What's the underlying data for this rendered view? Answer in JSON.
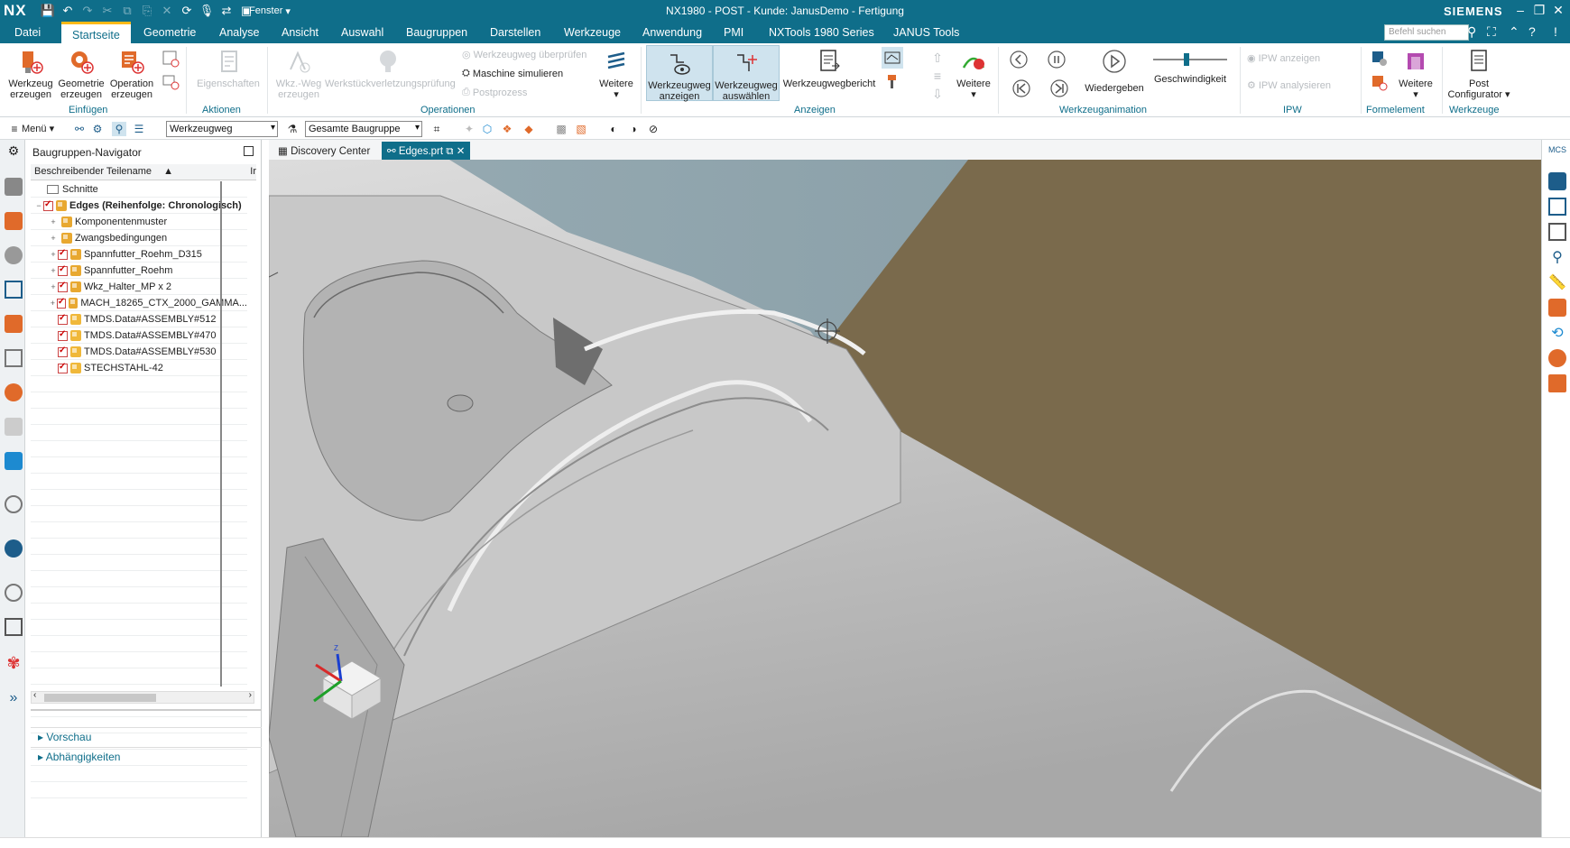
{
  "app": {
    "logo": "NX",
    "title": "NX1980 - POST - Kunde: JanusDemo - Fertigung",
    "brand": "SIEMENS",
    "fenster": "Fenster",
    "search_placeholder": "Befehl suchen"
  },
  "menu": [
    "Datei",
    "Startseite",
    "Geometrie",
    "Analyse",
    "Ansicht",
    "Auswahl",
    "Baugruppen",
    "Darstellen",
    "Werkzeuge",
    "Anwendung",
    "PMI",
    "NXTools 1980 Series",
    "JANUS Tools"
  ],
  "ribbon": {
    "werkzeug_erzeugen": [
      "Werkzeug",
      "erzeugen"
    ],
    "geometrie_erzeugen": [
      "Geometrie",
      "erzeugen"
    ],
    "operation_erzeugen": [
      "Operation",
      "erzeugen"
    ],
    "eigenschaften": "Eigenschaften",
    "wkz_weg_erzeugen": [
      "Wkz.-Weg",
      "erzeugen"
    ],
    "werkstuck": "Werkstückverletzungsprüfung",
    "werkzeugweg_uberprufen": "Werkzeugweg überprüfen",
    "maschine_simulieren": "Maschine simulieren",
    "postprozess": "Postprozess",
    "weitere_1": "Weitere",
    "werkzeugweg_anzeigen": [
      "Werkzeugweg",
      "anzeigen"
    ],
    "werkzeugweg_auswahlen": [
      "Werkzeugweg",
      "auswählen"
    ],
    "werkzeugwegbericht": "Werkzeugwegbericht",
    "weitere_2": "Weitere",
    "wiedergeben": "Wiedergeben",
    "geschwindigkeit": "Geschwindigkeit",
    "ipw_anzeigen": "IPW anzeigen",
    "ipw_analysieren": "IPW analysieren",
    "weitere_3": "Weitere",
    "post_configurator": [
      "Post",
      "Configurator"
    ],
    "groups": {
      "einfugen": "Einfügen",
      "aktionen": "Aktionen",
      "operationen": "Operationen",
      "anzeigen": "Anzeigen",
      "werkzeuganimation": "Werkzeuganimation",
      "ipw": "IPW",
      "formelement": "Formelement",
      "werkzeuge": "Werkzeuge"
    }
  },
  "toolbar": {
    "menu": "Menü",
    "filter_value": "Werkzeugweg",
    "scope_value": "Gesamte Baugruppe"
  },
  "navigator": {
    "title": "Baugruppen-Navigator",
    "column": "Beschreibender Teilename",
    "column2": "Ir",
    "items": [
      {
        "label": "Schnitte",
        "level": 0,
        "kind": "folder"
      },
      {
        "label": "Edges (Reihenfolge: Chronologisch)",
        "level": 0,
        "kind": "root"
      },
      {
        "label": "Komponentenmuster",
        "level": 1,
        "kind": "special"
      },
      {
        "label": "Zwangsbedingungen",
        "level": 1,
        "kind": "special"
      },
      {
        "label": "Spannfutter_Roehm_D315",
        "level": 1,
        "kind": "asm"
      },
      {
        "label": "Spannfutter_Roehm",
        "level": 1,
        "kind": "asm"
      },
      {
        "label": "Wkz_Halter_MP x 2",
        "level": 1,
        "kind": "asm"
      },
      {
        "label": "MACH_18265_CTX_2000_GAMMA...",
        "level": 1,
        "kind": "asm"
      },
      {
        "label": "TMDS.Data#ASSEMBLY#512",
        "level": 1,
        "kind": "part"
      },
      {
        "label": "TMDS.Data#ASSEMBLY#470",
        "level": 1,
        "kind": "part"
      },
      {
        "label": "TMDS.Data#ASSEMBLY#530",
        "level": 1,
        "kind": "part"
      },
      {
        "label": "STECHSTAHL-42",
        "level": 1,
        "kind": "part"
      }
    ],
    "panels": [
      "Vorschau",
      "Abhängigkeiten"
    ]
  },
  "tabs": [
    "Discovery Center",
    "Edges.prt"
  ],
  "colors": {
    "accent": "#0f6e8a",
    "highlight": "#fdb917",
    "background_wall": "#7a6a4c",
    "sky": "#8fa4ad"
  }
}
